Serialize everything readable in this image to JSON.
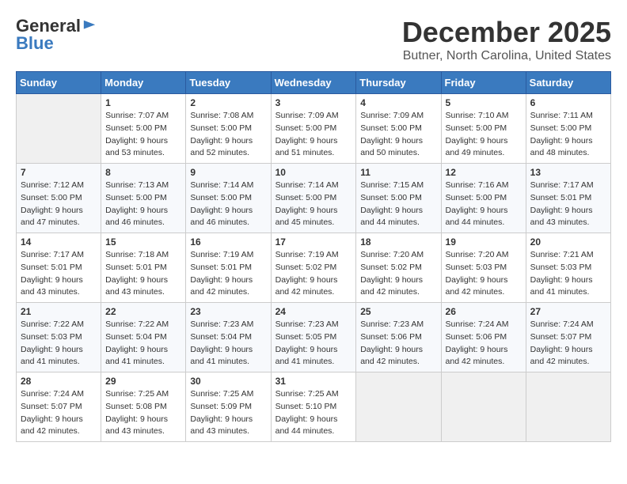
{
  "logo": {
    "general": "General",
    "blue": "Blue"
  },
  "title": "December 2025",
  "location": "Butner, North Carolina, United States",
  "days_of_week": [
    "Sunday",
    "Monday",
    "Tuesday",
    "Wednesday",
    "Thursday",
    "Friday",
    "Saturday"
  ],
  "weeks": [
    [
      {
        "day": "",
        "sunrise": "",
        "sunset": "",
        "daylight": ""
      },
      {
        "day": "1",
        "sunrise": "Sunrise: 7:07 AM",
        "sunset": "Sunset: 5:00 PM",
        "daylight": "Daylight: 9 hours and 53 minutes."
      },
      {
        "day": "2",
        "sunrise": "Sunrise: 7:08 AM",
        "sunset": "Sunset: 5:00 PM",
        "daylight": "Daylight: 9 hours and 52 minutes."
      },
      {
        "day": "3",
        "sunrise": "Sunrise: 7:09 AM",
        "sunset": "Sunset: 5:00 PM",
        "daylight": "Daylight: 9 hours and 51 minutes."
      },
      {
        "day": "4",
        "sunrise": "Sunrise: 7:09 AM",
        "sunset": "Sunset: 5:00 PM",
        "daylight": "Daylight: 9 hours and 50 minutes."
      },
      {
        "day": "5",
        "sunrise": "Sunrise: 7:10 AM",
        "sunset": "Sunset: 5:00 PM",
        "daylight": "Daylight: 9 hours and 49 minutes."
      },
      {
        "day": "6",
        "sunrise": "Sunrise: 7:11 AM",
        "sunset": "Sunset: 5:00 PM",
        "daylight": "Daylight: 9 hours and 48 minutes."
      }
    ],
    [
      {
        "day": "7",
        "sunrise": "Sunrise: 7:12 AM",
        "sunset": "Sunset: 5:00 PM",
        "daylight": "Daylight: 9 hours and 47 minutes."
      },
      {
        "day": "8",
        "sunrise": "Sunrise: 7:13 AM",
        "sunset": "Sunset: 5:00 PM",
        "daylight": "Daylight: 9 hours and 46 minutes."
      },
      {
        "day": "9",
        "sunrise": "Sunrise: 7:14 AM",
        "sunset": "Sunset: 5:00 PM",
        "daylight": "Daylight: 9 hours and 46 minutes."
      },
      {
        "day": "10",
        "sunrise": "Sunrise: 7:14 AM",
        "sunset": "Sunset: 5:00 PM",
        "daylight": "Daylight: 9 hours and 45 minutes."
      },
      {
        "day": "11",
        "sunrise": "Sunrise: 7:15 AM",
        "sunset": "Sunset: 5:00 PM",
        "daylight": "Daylight: 9 hours and 44 minutes."
      },
      {
        "day": "12",
        "sunrise": "Sunrise: 7:16 AM",
        "sunset": "Sunset: 5:00 PM",
        "daylight": "Daylight: 9 hours and 44 minutes."
      },
      {
        "day": "13",
        "sunrise": "Sunrise: 7:17 AM",
        "sunset": "Sunset: 5:01 PM",
        "daylight": "Daylight: 9 hours and 43 minutes."
      }
    ],
    [
      {
        "day": "14",
        "sunrise": "Sunrise: 7:17 AM",
        "sunset": "Sunset: 5:01 PM",
        "daylight": "Daylight: 9 hours and 43 minutes."
      },
      {
        "day": "15",
        "sunrise": "Sunrise: 7:18 AM",
        "sunset": "Sunset: 5:01 PM",
        "daylight": "Daylight: 9 hours and 43 minutes."
      },
      {
        "day": "16",
        "sunrise": "Sunrise: 7:19 AM",
        "sunset": "Sunset: 5:01 PM",
        "daylight": "Daylight: 9 hours and 42 minutes."
      },
      {
        "day": "17",
        "sunrise": "Sunrise: 7:19 AM",
        "sunset": "Sunset: 5:02 PM",
        "daylight": "Daylight: 9 hours and 42 minutes."
      },
      {
        "day": "18",
        "sunrise": "Sunrise: 7:20 AM",
        "sunset": "Sunset: 5:02 PM",
        "daylight": "Daylight: 9 hours and 42 minutes."
      },
      {
        "day": "19",
        "sunrise": "Sunrise: 7:20 AM",
        "sunset": "Sunset: 5:03 PM",
        "daylight": "Daylight: 9 hours and 42 minutes."
      },
      {
        "day": "20",
        "sunrise": "Sunrise: 7:21 AM",
        "sunset": "Sunset: 5:03 PM",
        "daylight": "Daylight: 9 hours and 41 minutes."
      }
    ],
    [
      {
        "day": "21",
        "sunrise": "Sunrise: 7:22 AM",
        "sunset": "Sunset: 5:03 PM",
        "daylight": "Daylight: 9 hours and 41 minutes."
      },
      {
        "day": "22",
        "sunrise": "Sunrise: 7:22 AM",
        "sunset": "Sunset: 5:04 PM",
        "daylight": "Daylight: 9 hours and 41 minutes."
      },
      {
        "day": "23",
        "sunrise": "Sunrise: 7:23 AM",
        "sunset": "Sunset: 5:04 PM",
        "daylight": "Daylight: 9 hours and 41 minutes."
      },
      {
        "day": "24",
        "sunrise": "Sunrise: 7:23 AM",
        "sunset": "Sunset: 5:05 PM",
        "daylight": "Daylight: 9 hours and 41 minutes."
      },
      {
        "day": "25",
        "sunrise": "Sunrise: 7:23 AM",
        "sunset": "Sunset: 5:06 PM",
        "daylight": "Daylight: 9 hours and 42 minutes."
      },
      {
        "day": "26",
        "sunrise": "Sunrise: 7:24 AM",
        "sunset": "Sunset: 5:06 PM",
        "daylight": "Daylight: 9 hours and 42 minutes."
      },
      {
        "day": "27",
        "sunrise": "Sunrise: 7:24 AM",
        "sunset": "Sunset: 5:07 PM",
        "daylight": "Daylight: 9 hours and 42 minutes."
      }
    ],
    [
      {
        "day": "28",
        "sunrise": "Sunrise: 7:24 AM",
        "sunset": "Sunset: 5:07 PM",
        "daylight": "Daylight: 9 hours and 42 minutes."
      },
      {
        "day": "29",
        "sunrise": "Sunrise: 7:25 AM",
        "sunset": "Sunset: 5:08 PM",
        "daylight": "Daylight: 9 hours and 43 minutes."
      },
      {
        "day": "30",
        "sunrise": "Sunrise: 7:25 AM",
        "sunset": "Sunset: 5:09 PM",
        "daylight": "Daylight: 9 hours and 43 minutes."
      },
      {
        "day": "31",
        "sunrise": "Sunrise: 7:25 AM",
        "sunset": "Sunset: 5:10 PM",
        "daylight": "Daylight: 9 hours and 44 minutes."
      },
      {
        "day": "",
        "sunrise": "",
        "sunset": "",
        "daylight": ""
      },
      {
        "day": "",
        "sunrise": "",
        "sunset": "",
        "daylight": ""
      },
      {
        "day": "",
        "sunrise": "",
        "sunset": "",
        "daylight": ""
      }
    ]
  ]
}
